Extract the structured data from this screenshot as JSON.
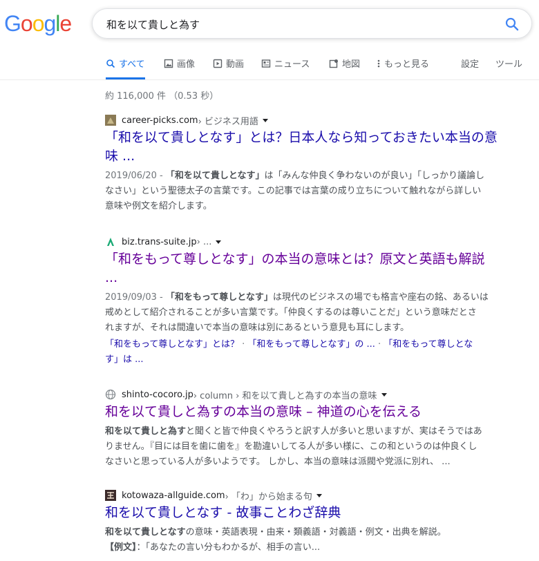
{
  "logo": {
    "text": "Google",
    "letters": [
      "G",
      "o",
      "o",
      "g",
      "l",
      "e"
    ],
    "colors": [
      "#4285F4",
      "#EA4335",
      "#FBBC05",
      "#4285F4",
      "#34A853",
      "#EA4335"
    ]
  },
  "search": {
    "query": "和を以て貴しと為す",
    "icon": "search-icon"
  },
  "tabs": [
    {
      "label": "すべて",
      "icon": "search-icon"
    },
    {
      "label": "画像",
      "icon": "image-icon"
    },
    {
      "label": "動画",
      "icon": "video-icon"
    },
    {
      "label": "ニュース",
      "icon": "news-icon"
    },
    {
      "label": "地図",
      "icon": "map-icon"
    },
    {
      "label": "もっと見る",
      "icon": "more-vert-icon"
    }
  ],
  "tools": {
    "settings": "設定",
    "tools": "ツール"
  },
  "stats": "約 116,000 件 （0.53 秒）",
  "results": [
    {
      "site": "career-picks.com",
      "breadcrumb": " › ビジネス用語",
      "title_line1": "「和を以て貴しとなす」とは？日本人なら知っておきたい本当の意",
      "title_line2": "味 ...",
      "date": "2019/06/20 - ",
      "snippet_bold": "「和を以て貴しとなす」",
      "snippet_line1_rest": "は「みんな仲良く争わないのが良い」「しっかり議論し",
      "snippet_line2": "なさい」という聖徳太子の言葉です。この記事では言葉の成り立ちについて触れながら詳しい",
      "snippet_line3": "意味や例文を紹介します。"
    },
    {
      "site": "biz.trans-suite.jp",
      "breadcrumb": " › ...",
      "title_line1": "「和をもって尊しとなす」の本当の意味とは？原文と英語も解説",
      "title_line2": "...",
      "date": "2019/09/03 - ",
      "snippet_bold": "「和をもって尊しとなす」",
      "snippet_line1_rest": "は現代のビジネスの場でも格言や座右の銘、あるいは",
      "snippet_line2": "戒めとして紹介されることが多い言葉です。「仲良くするのは尊いことだ」という意味だとさ",
      "snippet_line3": "れますが、それは間違いで本当の意味は別にあるという意見も耳にします。",
      "sitelink1": "「和をもって尊しとなす」とは？",
      "sep1": " · ",
      "sitelink2": "「和をもって尊しとなす」の ...",
      "sep2": " · ",
      "sitelink3_line1": "「和をもって尊しとな",
      "sitelink3_line2": "す」は ..."
    },
    {
      "site": "shinto-cocoro.jp",
      "breadcrumb": " › column › 和を以て貴しと為すの本当の意味",
      "title": "和を以て貴しと為すの本当の意味 – 神道の心を伝える",
      "snippet_bold": "和を以て貴しと為す",
      "snippet_line1_rest": "と聞くと皆で仲良くやろうと訳す人が多いと思いますが、実はそうではあ",
      "snippet_line2": "りません。『目には目を歯に歯を』を勘違いしてる人が多い様に、この和というのは仲良くし",
      "snippet_line3": "なさいと思っている人が多いようです。 しかし、本当の意味は派閥や党派に別れ、 ..."
    },
    {
      "site": "kotowaza-allguide.com",
      "breadcrumb": " › 「わ」から始まる句",
      "title": "和を以て貴しとなす - 故事ことわざ辞典",
      "snippet_bold": "和を以て貴しとなす",
      "snippet_line1_rest": "の意味・英語表現・由来・類義語・対義語・例文・出典を解説。",
      "example_label": "【例文】",
      "example_text": "：「あなたの言い分もわかるが、相手の言い..."
    }
  ]
}
